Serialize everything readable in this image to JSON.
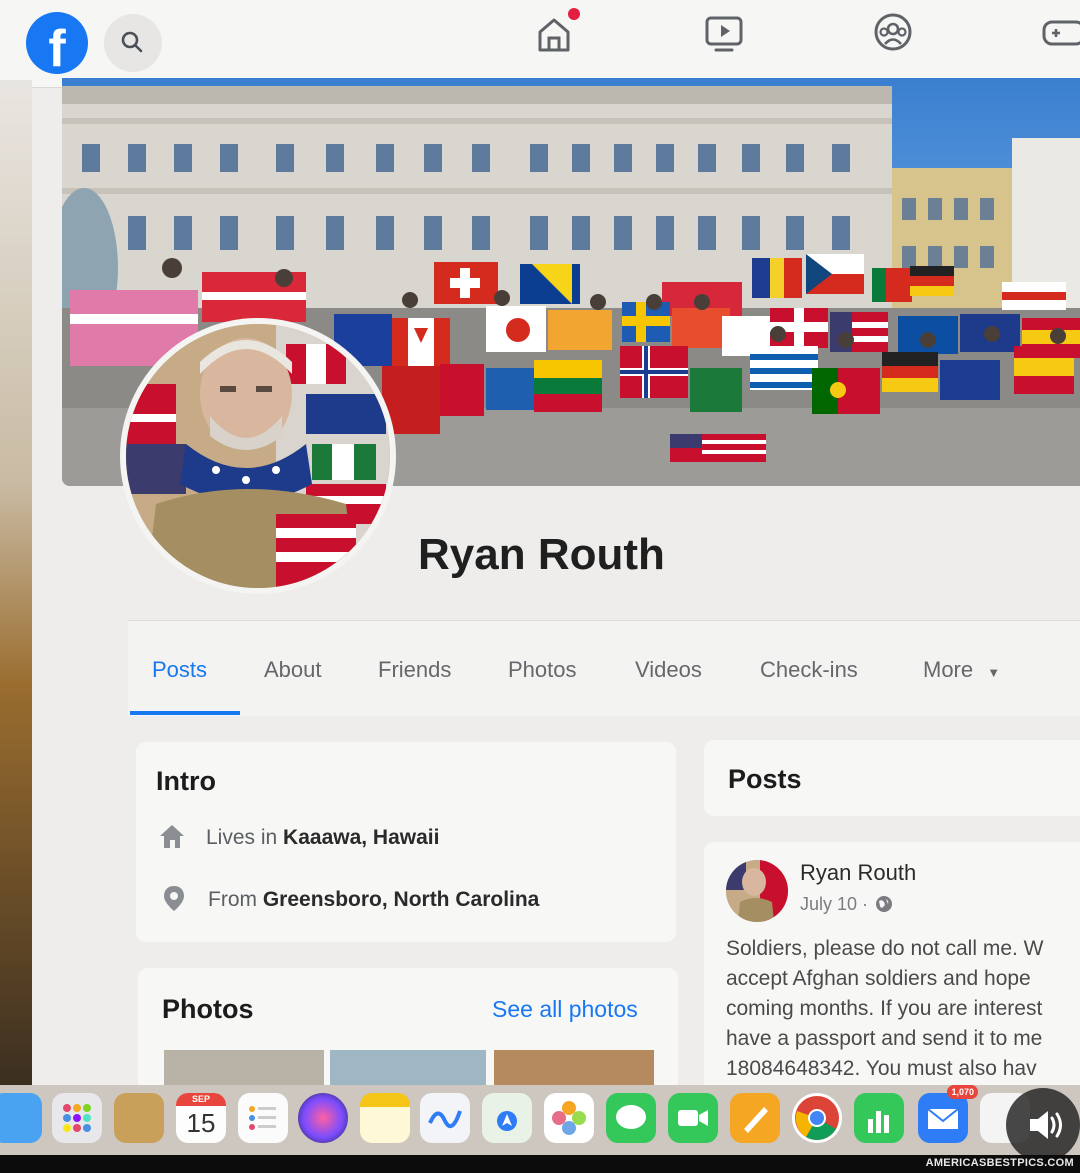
{
  "nav": {
    "logo_letter": "f",
    "icons": [
      "search-icon",
      "home-icon",
      "video-icon",
      "groups-icon",
      "gaming-icon"
    ],
    "home_notification": true
  },
  "profile": {
    "name": "Ryan Routh"
  },
  "tabs": [
    {
      "label": "Posts",
      "active": true
    },
    {
      "label": "About"
    },
    {
      "label": "Friends"
    },
    {
      "label": "Photos"
    },
    {
      "label": "Videos"
    },
    {
      "label": "Check-ins"
    },
    {
      "label": "More"
    }
  ],
  "intro": {
    "title": "Intro",
    "lives_prefix": "Lives in ",
    "lives_place": "Kaaawa, Hawaii",
    "from_prefix": "From ",
    "from_place": "Greensboro, North Carolina"
  },
  "photos": {
    "title": "Photos",
    "see_all": "See all photos"
  },
  "posts": {
    "title": "Posts",
    "post": {
      "author": "Ryan Routh",
      "date": "July 10 ·",
      "lines": [
        "Soldiers, please do not call me.  W",
        "accept Afghan soldiers and hope",
        "coming months. If you are interest",
        "have a passport and send it to me",
        "18084648342. You must also hav"
      ]
    }
  },
  "dock": {
    "calendar_month": "SEP",
    "calendar_day": "15",
    "mail_badge": "1,070"
  },
  "watermark": "AMERICASBESTPICS.COM",
  "colors": {
    "brand": "#1877f2",
    "notification": "#e41e3f"
  }
}
